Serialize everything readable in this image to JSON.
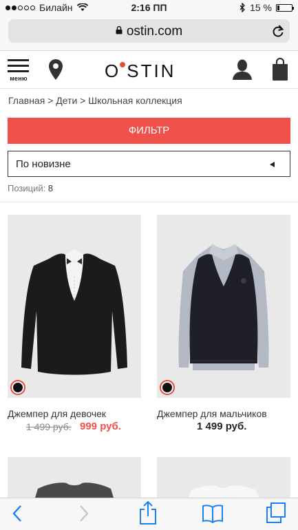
{
  "status_bar": {
    "carrier": "Билайн",
    "time": "2:16 ПП",
    "battery_text": "15 %",
    "battery_level": 0.15
  },
  "browser": {
    "url": "ostin.com"
  },
  "header": {
    "menu_label": "меню",
    "logo_left": "O",
    "logo_right": "STIN"
  },
  "breadcrumb": "Главная > Дети > Школьная коллекция",
  "filter_label": "ФИЛЬТР",
  "sort": {
    "selected": "По новизне"
  },
  "count": {
    "label": "Позиций:",
    "value": "8"
  },
  "products": [
    {
      "name": "Джемпер для девочек",
      "old_price": "1 499 руб.",
      "new_price": "999 руб."
    },
    {
      "name": "Джемпер для мальчиков",
      "price": "1 499 руб."
    }
  ],
  "colors": {
    "accent": "#f0504a",
    "logo_dot": "#e84b3c",
    "ios_blue": "#1a7ef5"
  },
  "toolbar_icons": [
    "back-icon",
    "forward-icon",
    "share-icon",
    "bookmarks-icon",
    "tabs-icon"
  ]
}
